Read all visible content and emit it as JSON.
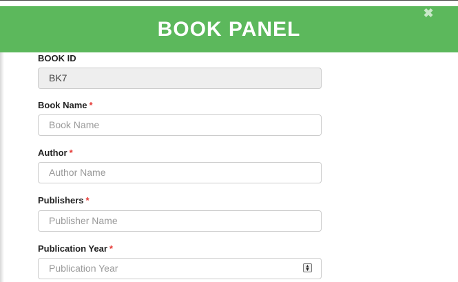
{
  "panel": {
    "title": "BOOK PANEL",
    "header_color": "#5cb85c",
    "close_icon": "close-icon"
  },
  "fields": {
    "book_id": {
      "label": "BOOK ID",
      "value": "BK7"
    },
    "book_name": {
      "label": "Book Name",
      "required_mark": "*",
      "placeholder": "Book Name"
    },
    "author": {
      "label": "Author",
      "required_mark": "*",
      "placeholder": "Author Name"
    },
    "publishers": {
      "label": "Publishers",
      "required_mark": "*",
      "placeholder": "Publisher Name"
    },
    "publication_year": {
      "label": "Publication Year",
      "required_mark": "*",
      "placeholder": "Publication Year"
    }
  }
}
